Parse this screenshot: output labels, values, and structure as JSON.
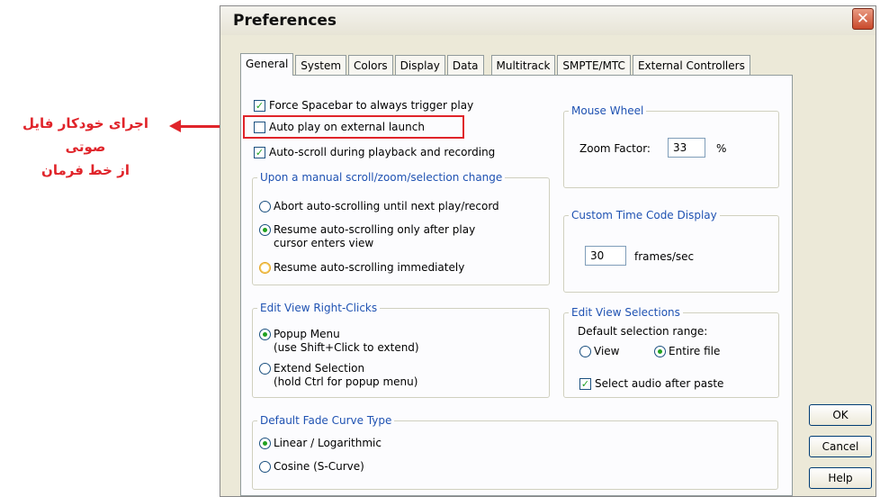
{
  "annotation": {
    "line1": "اجرای خودکار فایل صوتی",
    "line2": "از خط فرمان",
    "color": "#e0242a"
  },
  "window": {
    "title": "Preferences",
    "close_glyph": "✕"
  },
  "tabs": [
    "General",
    "System",
    "Colors",
    "Display",
    "Data",
    "Multitrack",
    "SMPTE/MTC",
    "External Controllers"
  ],
  "general": {
    "force_spacebar": {
      "label": "Force Spacebar to always trigger play",
      "checked": true
    },
    "auto_play": {
      "label": "Auto play on external launch",
      "checked": false
    },
    "auto_scroll": {
      "label": "Auto-scroll during playback and recording",
      "checked": true
    },
    "manual_scroll": {
      "legend": "Upon a manual scroll/zoom/selection change",
      "option1": "Abort auto-scrolling until next play/record",
      "option2_line1": "Resume auto-scrolling only after play",
      "option2_line2": "cursor enters view",
      "option3": "Resume auto-scrolling immediately",
      "selected": "option2"
    },
    "mouse_wheel": {
      "legend": "Mouse Wheel",
      "zoom_label": "Zoom Factor:",
      "zoom_value": "33",
      "unit": "%"
    },
    "time_code": {
      "legend": "Custom Time Code Display",
      "value": "30",
      "unit": "frames/sec"
    },
    "right_clicks": {
      "legend": "Edit View Right-Clicks",
      "option1_line1": "Popup Menu",
      "option1_line2": "(use Shift+Click to extend)",
      "option2_line1": "Extend Selection",
      "option2_line2": "(hold Ctrl for popup menu)",
      "selected": "option1"
    },
    "selections": {
      "legend": "Edit View Selections",
      "range_label": "Default selection range:",
      "view": "View",
      "entire_file": "Entire file",
      "selected": "entire_file",
      "select_audio": {
        "label": "Select audio after paste",
        "checked": true
      }
    },
    "fade": {
      "legend": "Default Fade Curve Type",
      "linear": "Linear / Logarithmic",
      "cosine": "Cosine (S-Curve)",
      "selected": "linear"
    }
  },
  "buttons": {
    "ok": "OK",
    "cancel": "Cancel",
    "help": "Help"
  }
}
